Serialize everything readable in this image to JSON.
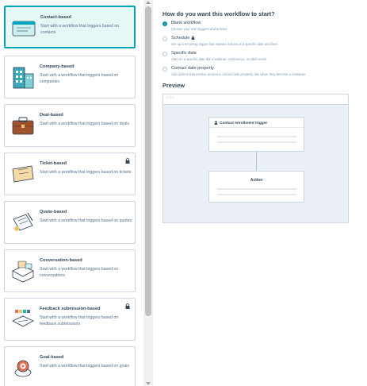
{
  "cards": [
    {
      "title": "Contact-based",
      "desc": "Start with a workflow that triggers based on contacts",
      "selected": true,
      "icon": "contact-illustration",
      "locked": false
    },
    {
      "title": "Company-based",
      "desc": "Start with a workflow that triggers based on companies",
      "selected": false,
      "icon": "company-illustration",
      "locked": false
    },
    {
      "title": "Deal-based",
      "desc": "Start with a workflow that triggers based on deals",
      "selected": false,
      "icon": "deal-illustration",
      "locked": false
    },
    {
      "title": "Ticket-based",
      "desc": "Start with a workflow that triggers based on tickets",
      "selected": false,
      "icon": "ticket-illustration",
      "locked": true
    },
    {
      "title": "Quote-based",
      "desc": "Start with a workflow that triggers based on quotes",
      "selected": false,
      "icon": "quote-illustration",
      "locked": false
    },
    {
      "title": "Conversation-based",
      "desc": "Start with a workflow that triggers based on conversations",
      "selected": false,
      "icon": "conversation-illustration",
      "locked": false
    },
    {
      "title": "Feedback submission-based",
      "desc": "Start with a workflow that triggers based on feedback submissions",
      "selected": false,
      "icon": "feedback-illustration",
      "locked": true
    },
    {
      "title": "Goal-based",
      "desc": "Start with a workflow that triggers based on goals",
      "selected": false,
      "icon": "goal-illustration",
      "locked": false
    }
  ],
  "right": {
    "question": "How do you want this workflow to start?",
    "options": [
      {
        "label": "Blank workflow",
        "desc": "Choose your own triggers and actions.",
        "selected": true,
        "locked": false
      },
      {
        "label": "Schedule",
        "desc": "Set up a recurring trigger that repeats actions at a specific date and time.",
        "selected": false,
        "locked": true
      },
      {
        "label": "Specific date",
        "desc": "Start on a specific date like a webinar, conference, or other event",
        "selected": false,
        "locked": false
      },
      {
        "label": "Contact date property",
        "desc": "Add actions that revolve around a contact date property, like when they become a customer.",
        "selected": false,
        "locked": false
      }
    ],
    "preview_title": "Preview",
    "preview_dots": "○○○",
    "trigger_label": "Contact enrollment trigger",
    "action_label": "Action"
  },
  "colors": {
    "accent": "#00a4bd",
    "selected_bg": "#e5f8f6",
    "border": "#cbd6e2",
    "canvas": "#eaf0f6",
    "text": "#33475b"
  }
}
